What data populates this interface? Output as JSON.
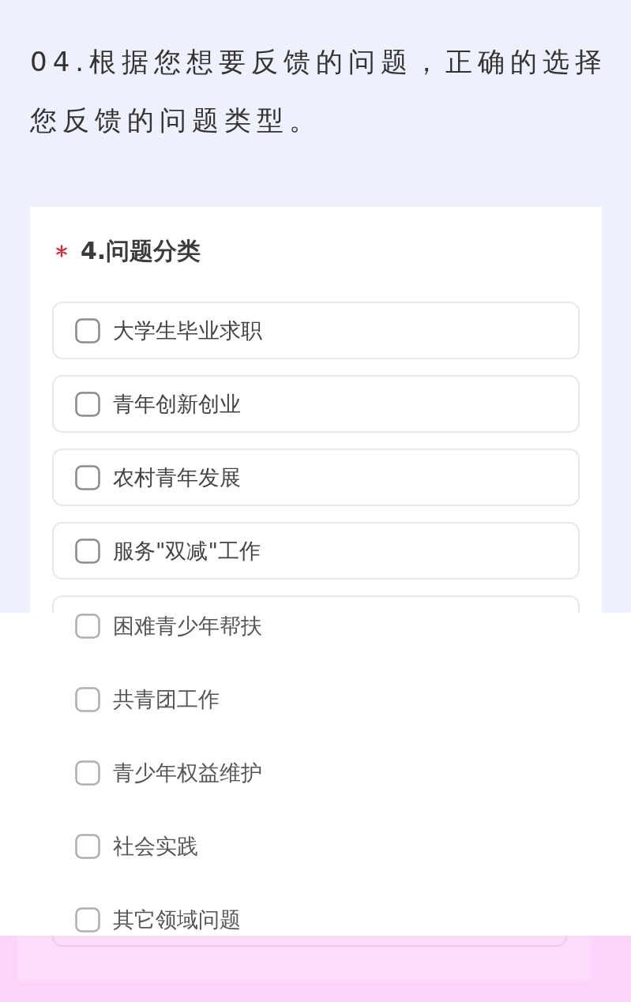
{
  "heading": "04.根据您想要反馈的问题，正确的选择您反馈的问题类型。",
  "question": {
    "required": true,
    "title": "4.问题分类",
    "options": [
      {
        "label": "大学生毕业求职",
        "checked": false,
        "kind": "boxed"
      },
      {
        "label": "青年创新创业",
        "checked": false,
        "kind": "boxed"
      },
      {
        "label": "农村青年发展",
        "checked": false,
        "kind": "boxed"
      },
      {
        "label": "服务\"双减\"工作",
        "checked": false,
        "kind": "boxed"
      },
      {
        "label": "困难青少年帮扶",
        "checked": false,
        "kind": "plain"
      },
      {
        "label": "共青团工作",
        "checked": false,
        "kind": "plain"
      },
      {
        "label": "青少年权益维护",
        "checked": false,
        "kind": "plain"
      },
      {
        "label": "社会实践",
        "checked": false,
        "kind": "plain"
      },
      {
        "label": "其它领域问题",
        "checked": false,
        "kind": "plain"
      }
    ]
  }
}
